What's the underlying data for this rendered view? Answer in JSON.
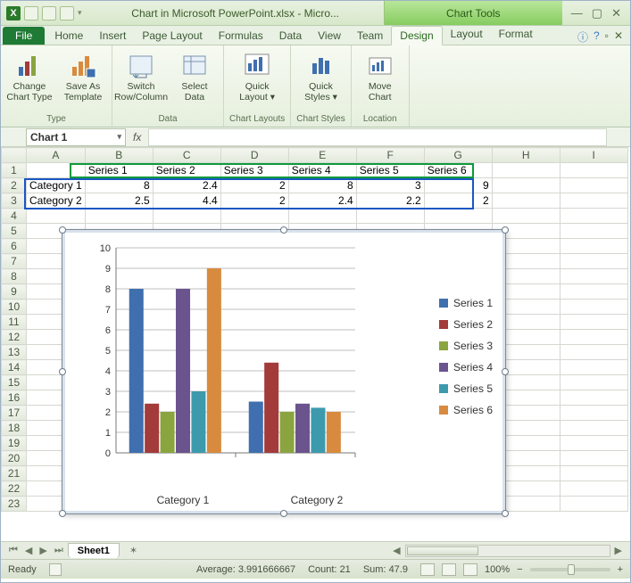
{
  "title": "Chart in Microsoft PowerPoint.xlsx - Micro...",
  "chart_tools_label": "Chart Tools",
  "tabs": {
    "file": "File",
    "list": [
      "Home",
      "Insert",
      "Page Layout",
      "Formulas",
      "Data",
      "View",
      "Team"
    ],
    "ctx": [
      "Design",
      "Layout",
      "Format"
    ],
    "active": "Design"
  },
  "ribbon": {
    "groups": [
      {
        "label": "Type",
        "buttons": [
          {
            "name": "change-chart-type",
            "label": "Change\nChart Type"
          },
          {
            "name": "save-as-template",
            "label": "Save As\nTemplate"
          }
        ]
      },
      {
        "label": "Data",
        "buttons": [
          {
            "name": "switch-row-column",
            "label": "Switch\nRow/Column"
          },
          {
            "name": "select-data",
            "label": "Select\nData"
          }
        ]
      },
      {
        "label": "Chart Layouts",
        "buttons": [
          {
            "name": "quick-layout",
            "label": "Quick\nLayout",
            "dd": true
          }
        ]
      },
      {
        "label": "Chart Styles",
        "buttons": [
          {
            "name": "quick-styles",
            "label": "Quick\nStyles",
            "dd": true
          }
        ]
      },
      {
        "label": "Location",
        "buttons": [
          {
            "name": "move-chart",
            "label": "Move\nChart"
          }
        ]
      }
    ]
  },
  "namebox": "Chart 1",
  "fx_label": "fx",
  "grid": {
    "cols": [
      "A",
      "B",
      "C",
      "D",
      "E",
      "F",
      "G",
      "H",
      "I"
    ],
    "rows": 23,
    "data": [
      [
        "",
        "Series 1",
        "Series 2",
        "Series 3",
        "Series 4",
        "Series 5",
        "Series 6"
      ],
      [
        "Category 1",
        "8",
        "2.4",
        "2",
        "8",
        "3",
        "9"
      ],
      [
        "Category 2",
        "2.5",
        "4.4",
        "2",
        "2.4",
        "2.2",
        "2"
      ]
    ]
  },
  "chart_data": {
    "type": "bar",
    "categories": [
      "Category 1",
      "Category 2"
    ],
    "series": [
      {
        "name": "Series 1",
        "values": [
          8,
          2.5
        ],
        "color": "#3f6fae"
      },
      {
        "name": "Series 2",
        "values": [
          2.4,
          4.4
        ],
        "color": "#a33b3b"
      },
      {
        "name": "Series 3",
        "values": [
          2,
          2
        ],
        "color": "#8aa43f"
      },
      {
        "name": "Series 4",
        "values": [
          8,
          2.4
        ],
        "color": "#6b548e"
      },
      {
        "name": "Series 5",
        "values": [
          3,
          2.2
        ],
        "color": "#3d9aad"
      },
      {
        "name": "Series 6",
        "values": [
          9,
          2
        ],
        "color": "#d88b3e"
      }
    ],
    "ylim": [
      0,
      10
    ],
    "yticks": [
      0,
      1,
      2,
      3,
      4,
      5,
      6,
      7,
      8,
      9,
      10
    ]
  },
  "sheet_tab": "Sheet1",
  "status": {
    "ready": "Ready",
    "average_label": "Average:",
    "average": "3.991666667",
    "count_label": "Count:",
    "count": "21",
    "sum_label": "Sum:",
    "sum": "47.9",
    "zoom": "100%"
  }
}
